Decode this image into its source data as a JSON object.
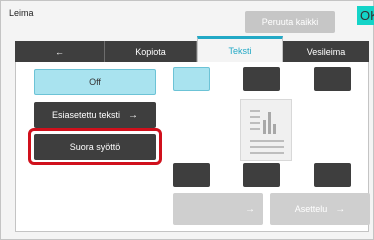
{
  "header": {
    "title": "Leima",
    "cancel_all_label": "Peruuta kaikki",
    "ok_label": "OK"
  },
  "tabs": [
    {
      "label": "←",
      "active": false
    },
    {
      "label": "Kopiota",
      "active": false
    },
    {
      "label": "Teksti",
      "active": true
    },
    {
      "label": "Vesileima",
      "active": false
    }
  ],
  "options": {
    "off_label": "Off",
    "preset_text_label": "Esiasetettu teksti",
    "preset_text_arrow": "→",
    "direct_input_label": "Suora syöttö"
  },
  "position_buttons": [
    {
      "slot": "top-left",
      "selected": true
    },
    {
      "slot": "top-center",
      "selected": false
    },
    {
      "slot": "top-right",
      "selected": false
    },
    {
      "slot": "bottom-left",
      "selected": false
    },
    {
      "slot": "bottom-center",
      "selected": false
    },
    {
      "slot": "bottom-right",
      "selected": false
    }
  ],
  "bottom_buttons": {
    "left_label": "",
    "left_arrow": "→",
    "layout_label": "Asettelu",
    "layout_arrow": "→"
  },
  "colors": {
    "accent": "#23a9c6",
    "selected_fill": "#a9e3ef",
    "dark_button": "#3e3e3e",
    "highlight_red": "#d0101c",
    "ok_button": "#14d4c8"
  },
  "icons": {
    "document_preview": "document-icon"
  }
}
